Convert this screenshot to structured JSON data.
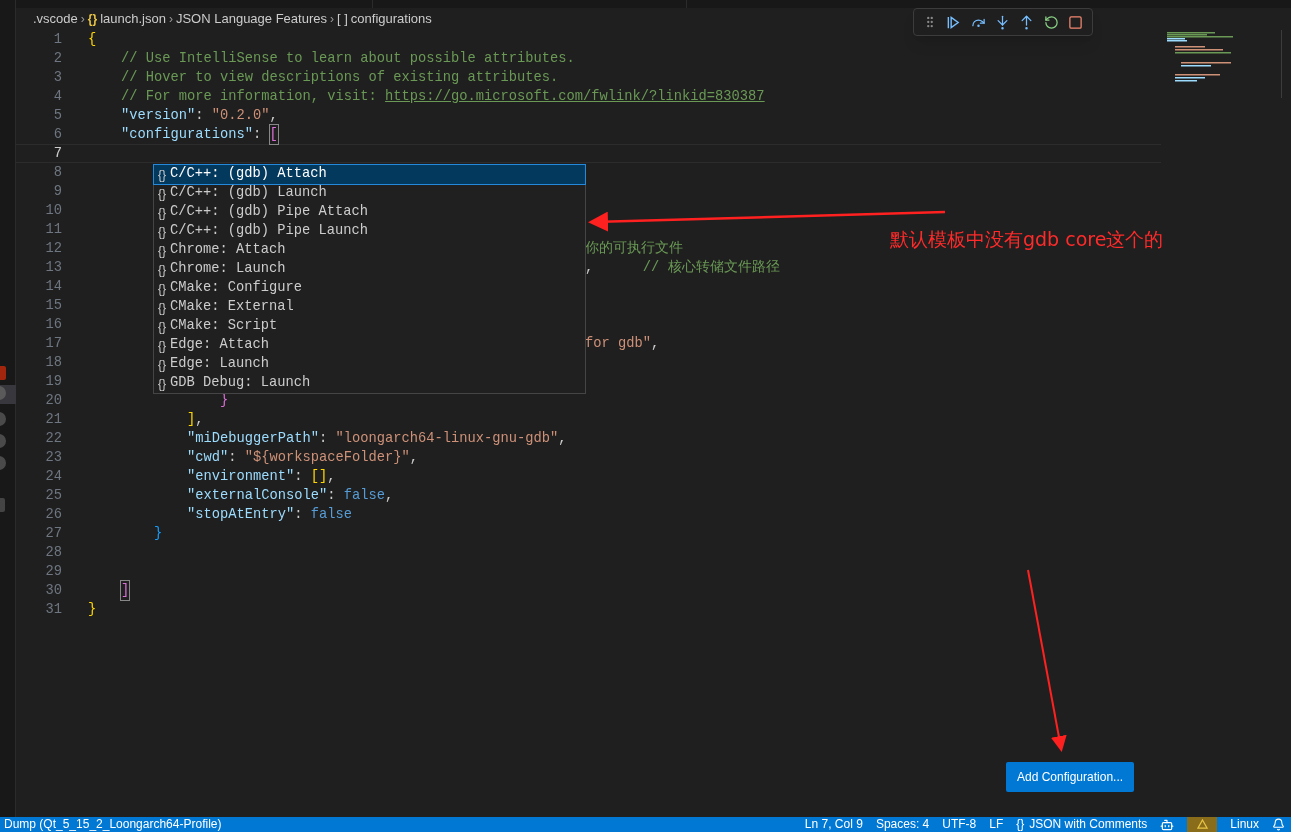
{
  "breadcrumbs": [
    {
      "label": ".vscode"
    },
    {
      "separator": "›",
      "icon": "{}",
      "label": "launch.json"
    },
    {
      "separator": "›",
      "label": "JSON Language Features"
    },
    {
      "separator": "›",
      "icon": "[ ]",
      "label": "configurations"
    }
  ],
  "lines": [
    {
      "n": "1",
      "tokens": [
        {
          "kind": "brace1",
          "text": "{"
        }
      ]
    },
    {
      "n": "2",
      "tokens": [
        {
          "kind": "comment",
          "text": "    // Use IntelliSense to learn about possible attributes."
        }
      ]
    },
    {
      "n": "3",
      "tokens": [
        {
          "kind": "comment",
          "text": "    // Hover to view descriptions of existing attributes."
        }
      ]
    },
    {
      "n": "4",
      "tokens": [
        {
          "kind": "comment",
          "text": "    // For more information, visit: "
        },
        {
          "kind": "link",
          "text": "https://go.microsoft.com/fwlink/?linkid=830387"
        }
      ]
    },
    {
      "n": "5",
      "tokens": [
        {
          "kind": "key",
          "text": "    \"version\""
        },
        {
          "kind": "punct",
          "text": ": "
        },
        {
          "kind": "str",
          "text": "\"0.2.0\""
        },
        {
          "kind": "punct",
          "text": ","
        }
      ]
    },
    {
      "n": "6",
      "tokens": [
        {
          "kind": "key",
          "text": "    \"configurations\""
        },
        {
          "kind": "punct",
          "text": ": "
        },
        {
          "kind": "brace2",
          "text": "[",
          "matched": true
        }
      ]
    },
    {
      "n": "7",
      "current": true
    },
    {
      "n": "8"
    },
    {
      "n": "9"
    },
    {
      "n": "10"
    },
    {
      "n": "11"
    },
    {
      "n": "12",
      "covered": true,
      "tokens": [
        {
          "kind": "comment",
          "text": "你的可执行文件"
        }
      ]
    },
    {
      "n": "13",
      "covered": true,
      "tokens": [
        {
          "kind": "punct",
          "text": ","
        },
        {
          "kind": "comment",
          "text": "      // 核心转储文件路径"
        }
      ]
    },
    {
      "n": "14"
    },
    {
      "n": "15"
    },
    {
      "n": "16"
    },
    {
      "n": "17",
      "covered": true,
      "tokens": [
        {
          "kind": "str",
          "text": "for gdb\""
        },
        {
          "kind": "punct",
          "text": ","
        }
      ]
    },
    {
      "n": "18"
    },
    {
      "n": "19"
    },
    {
      "n": "20",
      "tokens": [
        {
          "kind": "brace2",
          "text": "                }"
        }
      ]
    },
    {
      "n": "21",
      "tokens": [
        {
          "kind": "brace1",
          "text": "            ]"
        },
        {
          "kind": "punct",
          "text": ","
        }
      ]
    },
    {
      "n": "22",
      "tokens": [
        {
          "kind": "key",
          "text": "            \"miDebuggerPath\""
        },
        {
          "kind": "punct",
          "text": ": "
        },
        {
          "kind": "str",
          "text": "\"loongarch64-linux-gnu-gdb\""
        },
        {
          "kind": "punct",
          "text": ","
        }
      ]
    },
    {
      "n": "23",
      "tokens": [
        {
          "kind": "key",
          "text": "            \"cwd\""
        },
        {
          "kind": "punct",
          "text": ": "
        },
        {
          "kind": "str",
          "text": "\"${workspaceFolder}\""
        },
        {
          "kind": "punct",
          "text": ","
        }
      ]
    },
    {
      "n": "24",
      "tokens": [
        {
          "kind": "key",
          "text": "            \"environment\""
        },
        {
          "kind": "punct",
          "text": ": "
        },
        {
          "kind": "brace1",
          "text": "[]"
        },
        {
          "kind": "punct",
          "text": ","
        }
      ]
    },
    {
      "n": "25",
      "tokens": [
        {
          "kind": "key",
          "text": "            \"externalConsole\""
        },
        {
          "kind": "punct",
          "text": ": "
        },
        {
          "kind": "bool",
          "text": "false"
        },
        {
          "kind": "punct",
          "text": ","
        }
      ]
    },
    {
      "n": "26",
      "tokens": [
        {
          "kind": "key",
          "text": "            \"stopAtEntry\""
        },
        {
          "kind": "punct",
          "text": ": "
        },
        {
          "kind": "bool",
          "text": "false"
        }
      ]
    },
    {
      "n": "27",
      "tokens": [
        {
          "kind": "brace3",
          "text": "        }"
        }
      ]
    },
    {
      "n": "28"
    },
    {
      "n": "29"
    },
    {
      "n": "30",
      "tokens": [
        {
          "kind": "brace2",
          "text": "    ]",
          "matched": true
        }
      ]
    },
    {
      "n": "31",
      "tokens": [
        {
          "kind": "brace1",
          "text": "}"
        }
      ]
    }
  ],
  "suggestions": [
    {
      "icon": "{}",
      "label": "C/C++: (gdb) Attach",
      "selected": true
    },
    {
      "icon": "{}",
      "label": "C/C++: (gdb) Launch",
      "selected": false
    },
    {
      "icon": "{}",
      "label": "C/C++: (gdb) Pipe Attach",
      "selected": false
    },
    {
      "icon": "{}",
      "label": "C/C++: (gdb) Pipe Launch",
      "selected": false
    },
    {
      "icon": "{}",
      "label": "Chrome: Attach",
      "selected": false
    },
    {
      "icon": "{}",
      "label": "Chrome: Launch",
      "selected": false
    },
    {
      "icon": "{}",
      "label": "CMake: Configure",
      "selected": false
    },
    {
      "icon": "{}",
      "label": "CMake: External",
      "selected": false
    },
    {
      "icon": "{}",
      "label": "CMake: Script",
      "selected": false
    },
    {
      "icon": "{}",
      "label": "Edge: Attach",
      "selected": false
    },
    {
      "icon": "{}",
      "label": "Edge: Launch",
      "selected": false
    },
    {
      "icon": "{}",
      "label": "GDB Debug: Launch",
      "selected": false
    }
  ],
  "annotation": {
    "text": "默认模板中没有gdb core这个的"
  },
  "add_configuration_button": "Add Configuration...",
  "status_bar": {
    "left": "Dump (Qt_5_15_2_Loongarch64-Profile)",
    "position": "Ln 7, Col 9",
    "indent": "Spaces: 4",
    "encoding": "UTF-8",
    "eol": "LF",
    "language_icon": "{}",
    "language": "JSON with Comments",
    "platform": "Linux"
  }
}
